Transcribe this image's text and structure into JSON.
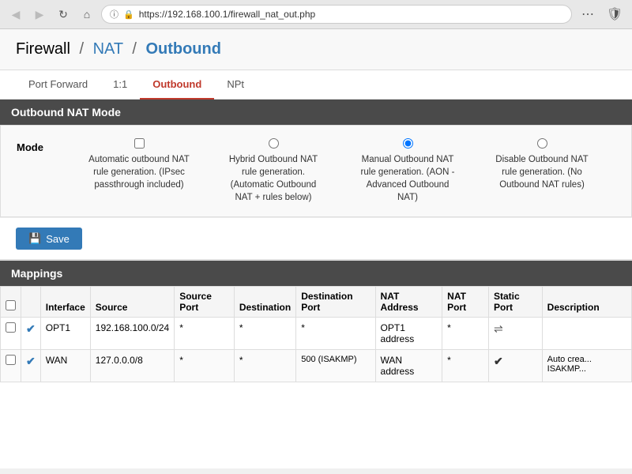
{
  "browser": {
    "url": "https://192.168.100.1/firewall_nat_out.php",
    "back_icon": "◀",
    "forward_icon": "▶",
    "refresh_icon": "↺",
    "home_icon": "⌂",
    "menu_icon": "⋯",
    "shield_icon": "🛡",
    "lock_icon": "🔒"
  },
  "breadcrumb": {
    "firewall": "Firewall",
    "sep1": "/",
    "nat": "NAT",
    "sep2": "/",
    "current": "Outbound"
  },
  "tabs": [
    {
      "id": "port-forward",
      "label": "Port Forward",
      "active": false
    },
    {
      "id": "1to1",
      "label": "1:1",
      "active": false
    },
    {
      "id": "outbound",
      "label": "Outbound",
      "active": true
    },
    {
      "id": "npt",
      "label": "NPt",
      "active": false
    }
  ],
  "nat_mode": {
    "section_title": "Outbound NAT Mode",
    "mode_label": "Mode",
    "options": [
      {
        "id": "automatic",
        "checked": false,
        "type": "checkbox",
        "text": "Automatic outbound NAT rule generation. (IPsec passthrough included)"
      },
      {
        "id": "hybrid",
        "checked": false,
        "type": "radio",
        "text": "Hybrid Outbound NAT rule generation. (Automatic Outbound NAT + rules below)"
      },
      {
        "id": "manual",
        "checked": true,
        "type": "radio",
        "text": "Manual Outbound NAT rule generation. (AON - Advanced Outbound NAT)"
      },
      {
        "id": "disable",
        "checked": false,
        "type": "radio",
        "text": "Disable Outbound NAT rule generation. (No Outbound NAT rules)"
      }
    ]
  },
  "save_button": "Save",
  "mappings": {
    "section_title": "Mappings",
    "columns": [
      {
        "label": ""
      },
      {
        "label": ""
      },
      {
        "label": "Interface"
      },
      {
        "label": "Source"
      },
      {
        "label": "Source Port"
      },
      {
        "label": "Destination"
      },
      {
        "label": "Destination Port"
      },
      {
        "label": "NAT Address"
      },
      {
        "label": "NAT Port"
      },
      {
        "label": "Static Port"
      },
      {
        "label": "Description"
      }
    ],
    "rows": [
      {
        "checkbox": false,
        "enabled": true,
        "interface": "OPT1",
        "source": "192.168.100.0/24",
        "source_port": "*",
        "destination": "*",
        "destination_port": "*",
        "nat_address": "OPT1 address",
        "nat_port": "*",
        "static_port": "shuffle",
        "description": ""
      },
      {
        "checkbox": false,
        "enabled": true,
        "interface": "WAN",
        "source": "127.0.0.0/8",
        "source_port": "*",
        "destination": "*",
        "destination_port": "500 (ISAKMP)",
        "nat_address": "WAN address",
        "nat_port": "*",
        "static_port": "checkmark",
        "description": "Auto crea... ISAKMP..."
      }
    ]
  }
}
